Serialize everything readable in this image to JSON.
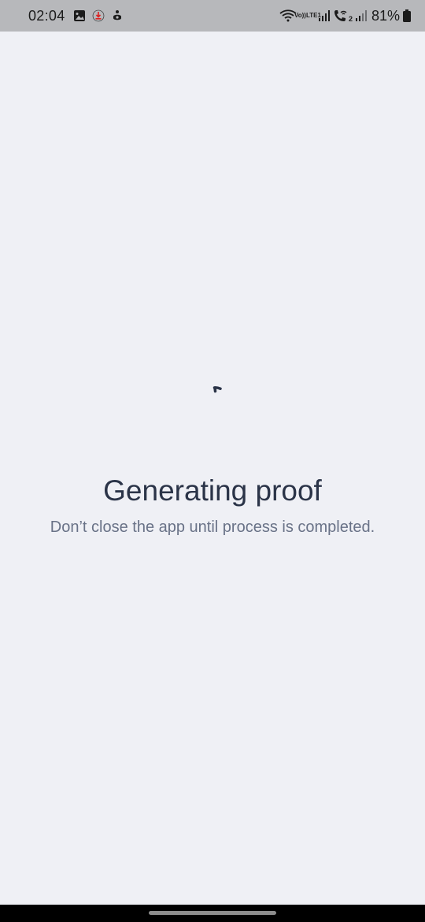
{
  "status_bar": {
    "time": "02:04",
    "volte_label_top": "Vo))",
    "volte_label_bottom": "LTE1",
    "sim2_label": "2",
    "battery_percent": "81%",
    "icons": [
      "image-icon",
      "download-alert-icon",
      "accessibility-icon",
      "wifi-icon",
      "volte-icon",
      "signal-icon",
      "wifi-calling-icon",
      "signal-icon",
      "battery-icon"
    ]
  },
  "main": {
    "title": "Generating proof",
    "subtitle": "Don’t close the app until process is completed."
  },
  "colors": {
    "background": "#eff0f5",
    "status_bar": "#b7b8bb",
    "title": "#2b3448",
    "subtitle": "#697287",
    "spinner": "#2b3448"
  }
}
